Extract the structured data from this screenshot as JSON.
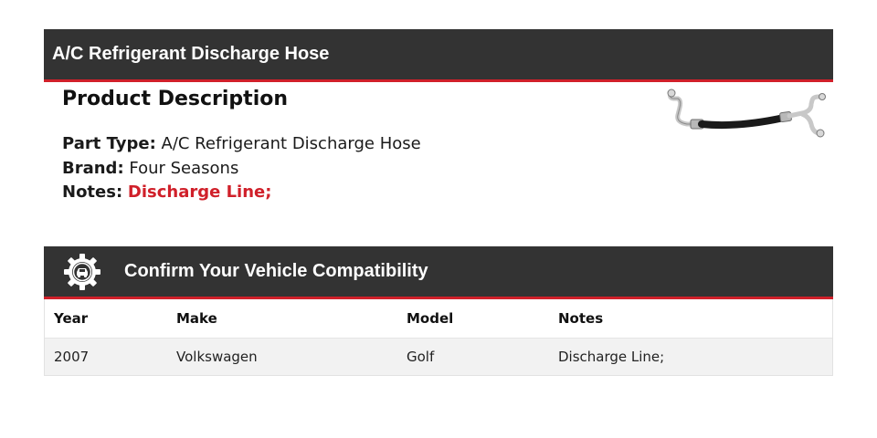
{
  "header": {
    "title": "A/C Refrigerant Discharge Hose"
  },
  "description": {
    "heading": "Product Description",
    "part_type_label": "Part Type:",
    "part_type_value": "A/C Refrigerant Discharge Hose",
    "brand_label": "Brand:",
    "brand_value": "Four Seasons",
    "notes_label": "Notes:",
    "notes_value": "Discharge Line;"
  },
  "compatibility": {
    "title": "Confirm Your Vehicle Compatibility",
    "columns": [
      "Year",
      "Make",
      "Model",
      "Notes"
    ],
    "rows": [
      [
        "2007",
        "Volkswagen",
        "Golf",
        "Discharge Line;"
      ]
    ]
  },
  "colors": {
    "bar": "#333333",
    "accent": "#d0202a",
    "row_bg": "#f2f2f2"
  },
  "icons": {
    "product_image": "hose-image",
    "gear": "gear-car-icon"
  }
}
